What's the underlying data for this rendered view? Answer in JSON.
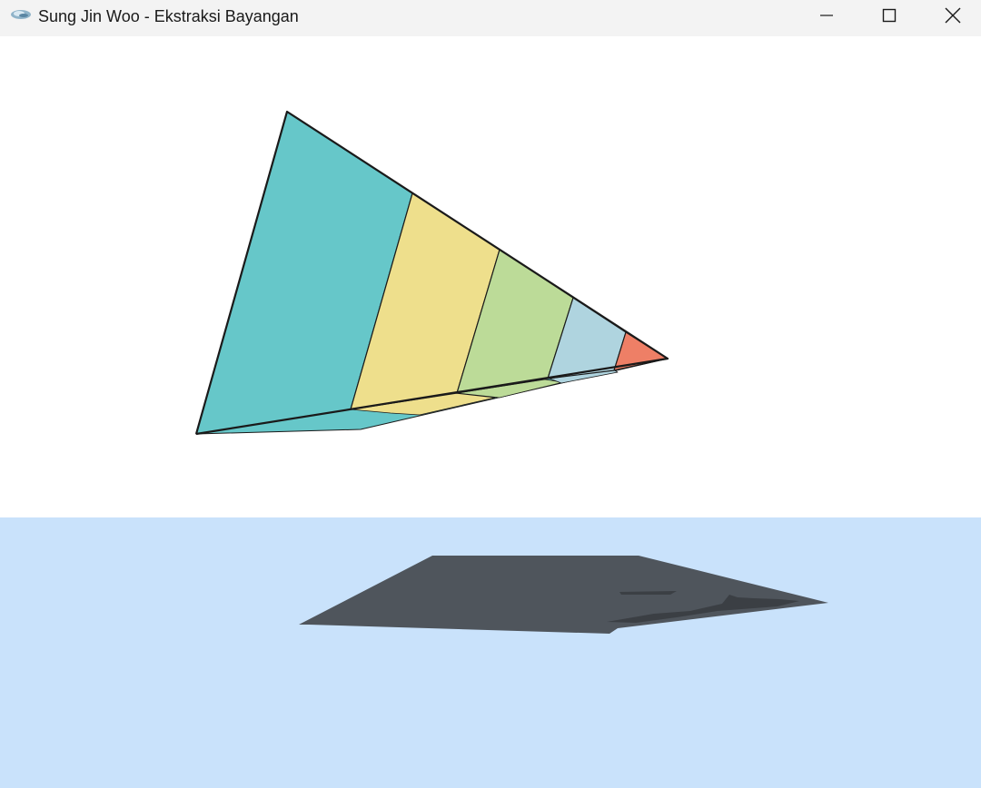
{
  "window": {
    "title": "Sung Jin Woo - Ekstraksi Bayangan",
    "controls": {
      "minimize_icon": "minimize-icon",
      "maximize_icon": "maximize-icon",
      "close_icon": "close-icon"
    }
  },
  "scene": {
    "background_color": "#ffffff",
    "ground_color": "#c9e2fb",
    "shadow_color": "#4f555c",
    "outline_color": "#1a1a1a",
    "band_colors": [
      "#66c7c9",
      "#eedf8c",
      "#bcdb98",
      "#afd4df",
      "#ee7f66"
    ]
  }
}
